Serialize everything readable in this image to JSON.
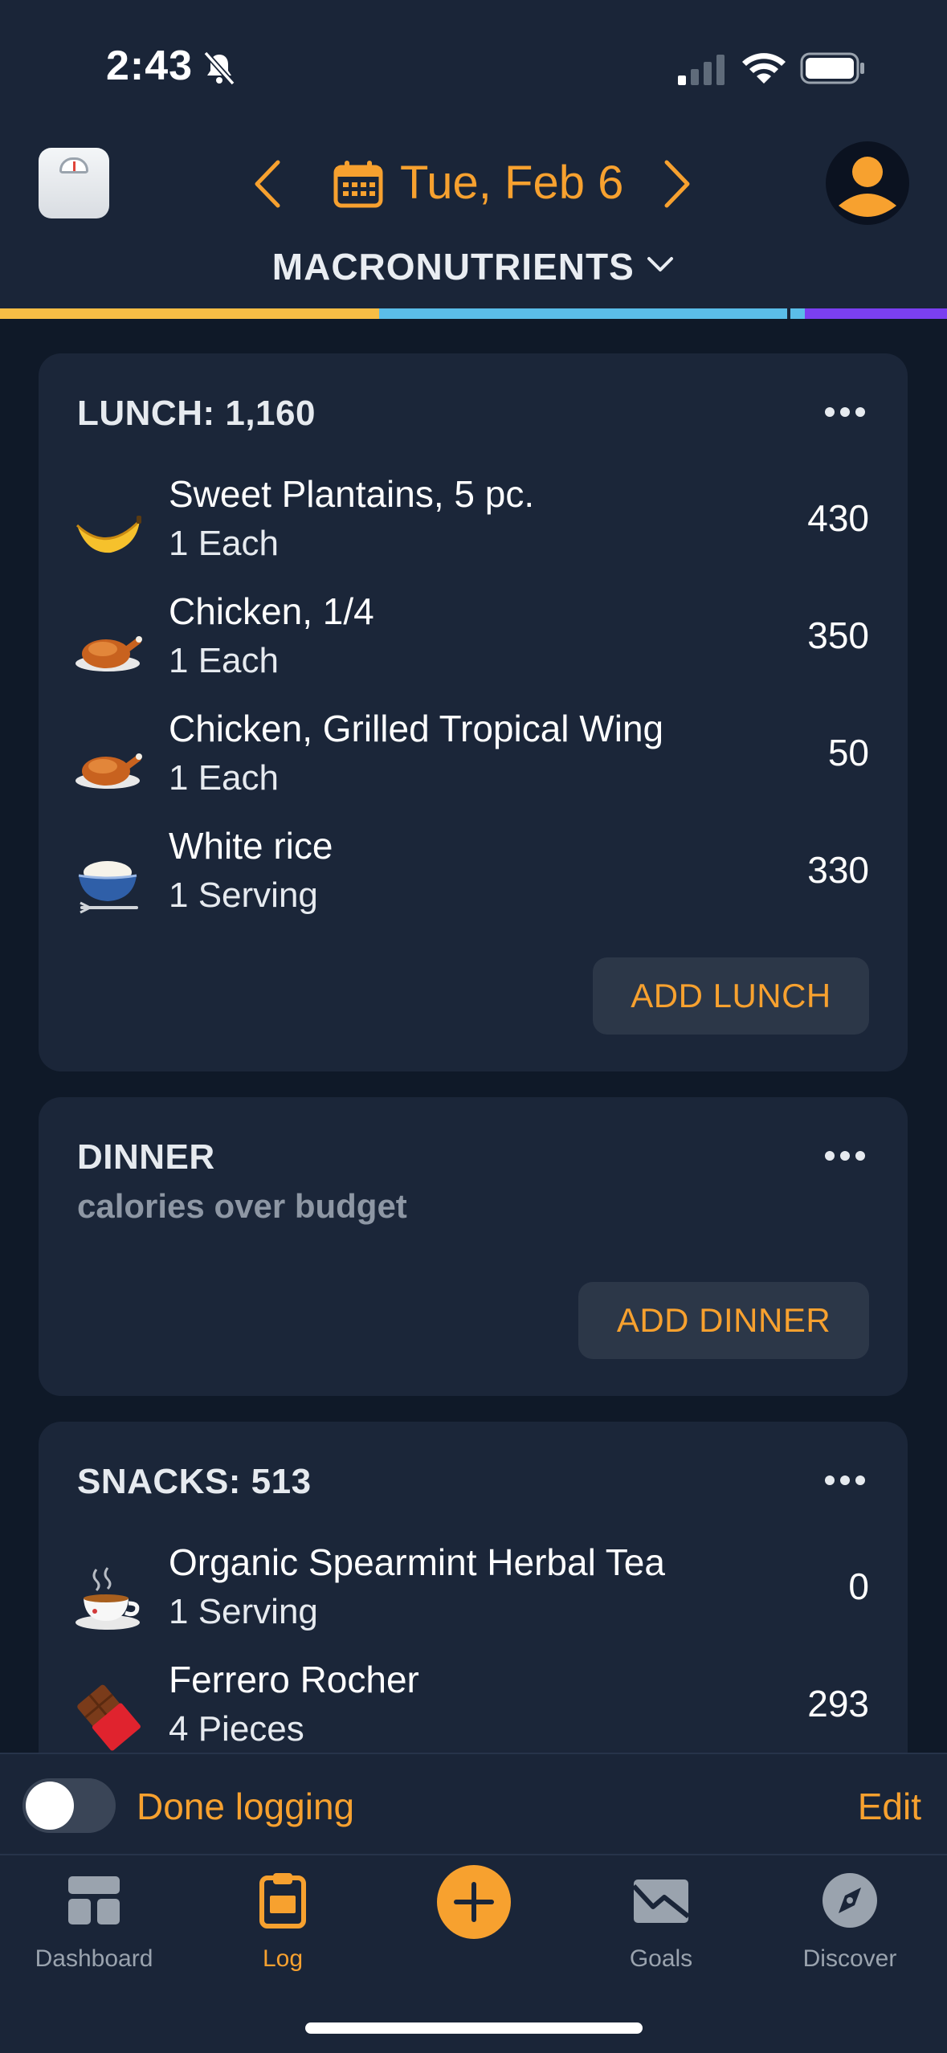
{
  "status_bar": {
    "time": "2:43",
    "icons": [
      "bell-muted-icon",
      "signal-icon",
      "wifi-icon",
      "battery-icon"
    ]
  },
  "header": {
    "date": "Tue, Feb 6",
    "view_selector": "MACRONUTRIENTS",
    "icons": [
      "scale-icon",
      "chevron-left-icon",
      "calendar-icon",
      "chevron-right-icon",
      "avatar-icon"
    ]
  },
  "macro_bar": {
    "colors": [
      "#f7bd45",
      "#5bbde8",
      "#5bbde8",
      "#7b3ff0"
    ],
    "fractions": [
      0.4,
      0.43,
      0.02,
      0.15
    ]
  },
  "lunch": {
    "title": "LUNCH: 1,160",
    "items": [
      {
        "name": "Sweet Plantains, 5 pc.",
        "serving": "1 Each",
        "calories": "430",
        "icon": "banana-icon"
      },
      {
        "name": "Chicken, 1/4",
        "serving": "1 Each",
        "calories": "350",
        "icon": "roast-chicken-icon"
      },
      {
        "name": "Chicken, Grilled Tropical Wing",
        "serving": "1 Each",
        "calories": "50",
        "icon": "roast-chicken-icon"
      },
      {
        "name": "White rice",
        "serving": "1 Serving",
        "calories": "330",
        "icon": "rice-bowl-icon"
      }
    ],
    "add_label": "ADD LUNCH"
  },
  "dinner": {
    "title": "DINNER",
    "subtitle": "calories over budget",
    "add_label": "ADD DINNER"
  },
  "snacks": {
    "title": "SNACKS: 513",
    "items": [
      {
        "name": "Organic Spearmint Herbal Tea",
        "serving": "1 Serving",
        "calories": "0",
        "icon": "tea-cup-icon"
      },
      {
        "name": "Ferrero Rocher",
        "serving": "4 Pieces",
        "calories": "293",
        "icon": "chocolate-bar-icon"
      }
    ]
  },
  "footer": {
    "done_label": "Done logging",
    "edit_label": "Edit",
    "done_toggle_on": false
  },
  "tabs": [
    {
      "label": "Dashboard",
      "icon": "dashboard-icon",
      "active": false
    },
    {
      "label": "Log",
      "icon": "clipboard-icon",
      "active": true
    },
    {
      "label": "",
      "icon": "add-icon",
      "active": false
    },
    {
      "label": "Goals",
      "icon": "goals-icon",
      "active": false
    },
    {
      "label": "Discover",
      "icon": "compass-icon",
      "active": false
    }
  ],
  "colors": {
    "accent": "#f7a12f",
    "background": "#0f1928",
    "card": "#1b2639",
    "header": "#1a2538"
  }
}
